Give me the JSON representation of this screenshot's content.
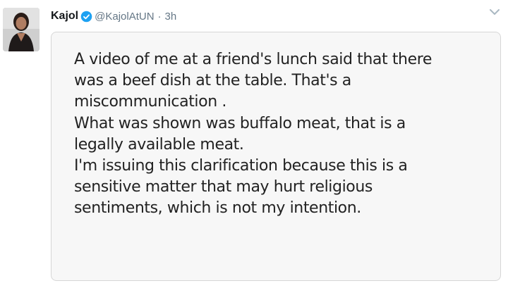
{
  "tweet": {
    "display_name": "Kajol",
    "handle": "@KajolAtUN",
    "separator": "·",
    "time": "3h",
    "avatar_icon": "user-avatar-photo",
    "verified_icon": "verified-badge-icon",
    "menu_icon": "chevron-down-icon",
    "verified_color": "#1da1f2",
    "image_text_lines": [
      "A video of me at a friend's lunch said that there",
      "was a beef dish at the table. That's a",
      "miscommunication .",
      "What was shown was buffalo meat, that is a",
      "legally available meat.",
      "I'm issuing this clarification because this is a",
      "sensitive matter that may hurt religious",
      "sentiments, which is not my intention."
    ]
  }
}
